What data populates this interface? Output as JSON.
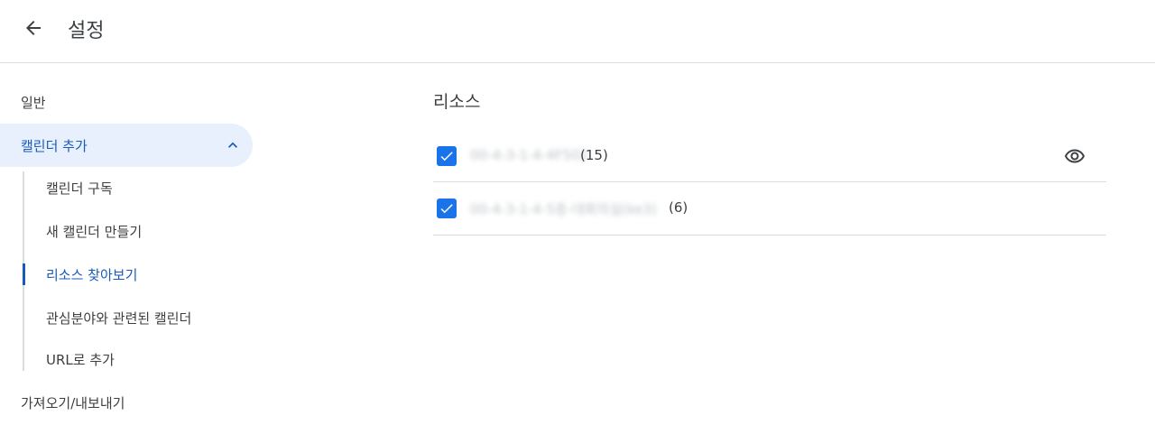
{
  "header": {
    "title": "설정"
  },
  "sidebar": {
    "general": "일반",
    "add_calendar": "캘린더 추가",
    "sub_items": [
      "캘린더 구독",
      "새 캘린더 만들기",
      "리소스 찾아보기",
      "관심분야와 관련된 캘린더",
      "URL로 추가"
    ],
    "import_export": "가져오기/내보내기"
  },
  "main": {
    "section_title": "리소스",
    "resources": [
      {
        "name": "00-4-3-1-4-4F502",
        "count": "(15)",
        "checked": true
      },
      {
        "name": "00-4-3-1-4-5층-대회의실(ke3)",
        "count": "(6)",
        "checked": true
      }
    ]
  },
  "colors": {
    "accent": "#1a73e8",
    "active_text": "#185abc",
    "active_bg": "#e8f0fe",
    "divider": "#dadce0"
  },
  "icons": {
    "back": "arrow-back-icon",
    "expand": "chevron-up-icon",
    "check": "check-icon",
    "view": "eye-icon"
  }
}
